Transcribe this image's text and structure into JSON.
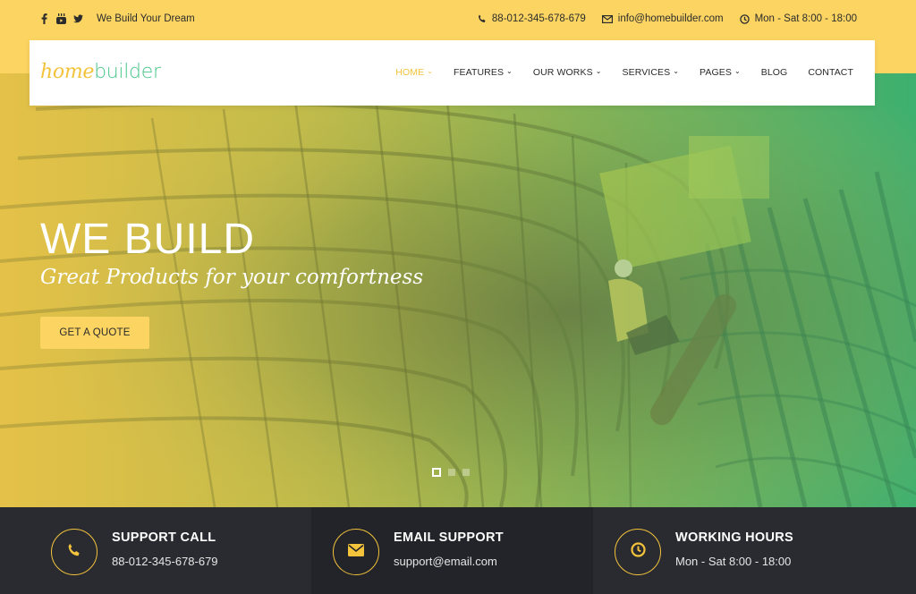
{
  "topbar": {
    "social": [
      {
        "icon": "facebook-icon"
      },
      {
        "icon": "youtube-icon"
      },
      {
        "icon": "twitter-icon"
      }
    ],
    "tagline": "We Build Your Dream",
    "phone": "88-012-345-678-679",
    "email": "info@homebuilder.com",
    "hours": "Mon - Sat 8:00 - 18:00"
  },
  "header": {
    "logo_part1": "home",
    "logo_part2": "builder",
    "nav": [
      {
        "label": "HOME",
        "dropdown": true,
        "active": true
      },
      {
        "label": "FEATURES",
        "dropdown": true
      },
      {
        "label": "OUR WORKS",
        "dropdown": true
      },
      {
        "label": "SERVICES",
        "dropdown": true
      },
      {
        "label": "PAGES",
        "dropdown": true
      },
      {
        "label": "BLOG",
        "dropdown": false
      },
      {
        "label": "CONTACT",
        "dropdown": false
      }
    ]
  },
  "hero": {
    "title": "WE BUILD",
    "subtitle": "Great Products for your comfortness",
    "button": "GET A QUOTE",
    "slides": 3,
    "active_slide": 1
  },
  "info": [
    {
      "title": "SUPPORT CALL",
      "text": "88-012-345-678-679",
      "icon": "phone-icon"
    },
    {
      "title": "EMAIL SUPPORT",
      "text": "support@email.com",
      "icon": "envelope-icon"
    },
    {
      "title": "WORKING HOURS",
      "text": "Mon - Sat 8:00 - 18:00",
      "icon": "clock-icon"
    }
  ],
  "colors": {
    "accent": "#fcd462",
    "accent_text": "#f3c33b",
    "green": "#49c58a",
    "dark": "#2a2b31",
    "dark_alt": "#232429"
  }
}
